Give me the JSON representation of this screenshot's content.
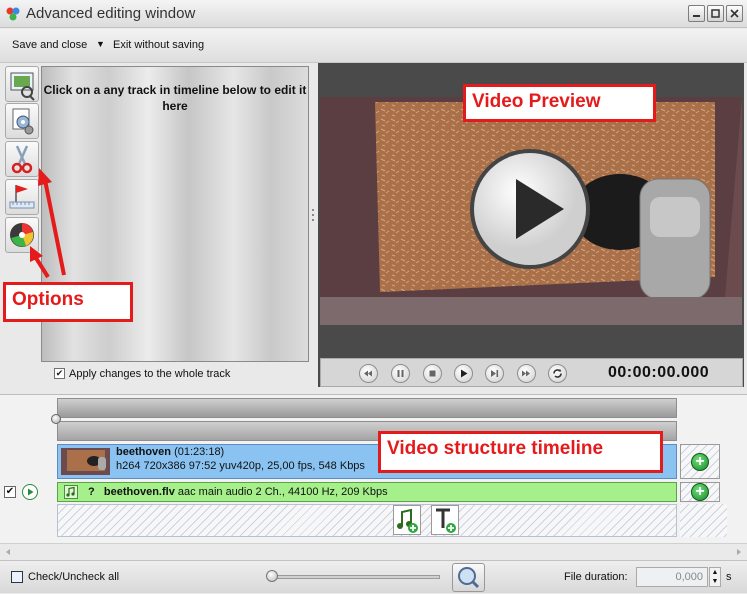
{
  "window": {
    "title": "Advanced editing window",
    "controls": [
      "minimize",
      "maximize",
      "close"
    ]
  },
  "toolbar": {
    "save_close": "Save and close",
    "exit_no_save": "Exit without saving"
  },
  "left_tools": [
    {
      "icon": "video-frame-icon"
    },
    {
      "icon": "settings-document-icon"
    },
    {
      "icon": "scissors-icon"
    },
    {
      "icon": "chapter-flag-icon"
    },
    {
      "icon": "color-wheel-icon"
    }
  ],
  "edit_panel": {
    "hint": "Click on a any track in timeline below to edit it here",
    "apply_label": "Apply changes to the whole track",
    "apply_checked": true
  },
  "player": {
    "timecode": "00:00:00.000",
    "buttons": [
      "rewind-icon",
      "pause-icon",
      "stop-icon",
      "play-icon",
      "next-icon",
      "forward-icon",
      "loop-icon"
    ]
  },
  "annotations": {
    "preview": "Video Preview",
    "options": "Options",
    "timeline": "Video structure timeline"
  },
  "timeline": {
    "video_track": {
      "name": "beethoven",
      "duration": "(01:23:18)",
      "specs": "h264 720x386 97:52 yuv420p, 25,00 fps, 548 Kbps"
    },
    "audio_track": {
      "status": "?",
      "file": "beethoven.flv",
      "specs": "aac main audio 2 Ch., 44100 Hz, 209 Kbps"
    }
  },
  "statusbar": {
    "check_all": "Check/Uncheck all",
    "file_duration_label": "File duration:",
    "file_duration_value": "0,000",
    "unit": "s"
  },
  "colors": {
    "annotation_red": "#e51b1b",
    "video_track": "#8ac3f2",
    "audio_track": "#a6f08c"
  }
}
